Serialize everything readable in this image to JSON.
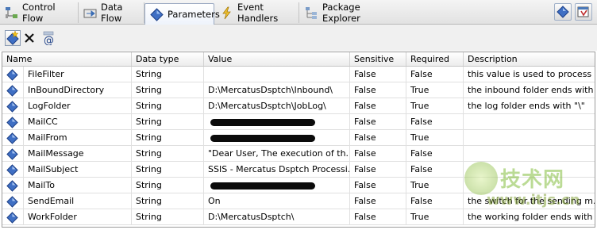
{
  "tabs": [
    {
      "label": "Control Flow",
      "icon": "control-flow-icon"
    },
    {
      "label": "Data Flow",
      "icon": "data-flow-icon"
    },
    {
      "label": "Parameters",
      "icon": "parameters-icon",
      "active": true
    },
    {
      "label": "Event Handlers",
      "icon": "event-handlers-icon"
    },
    {
      "label": "Package Explorer",
      "icon": "package-explorer-icon"
    }
  ],
  "toolbar": {
    "items": [
      "add-parameter-icon",
      "delete-parameter-icon",
      "add-to-configurations-icon"
    ]
  },
  "grid": {
    "columns": [
      "Name",
      "Data type",
      "Value",
      "Sensitive",
      "Required",
      "Description"
    ],
    "rows": [
      {
        "name": "FileFilter",
        "type": "String",
        "value": "",
        "redacted": false,
        "sensitive": "False",
        "required": "False",
        "description": "this value is used to process ..."
      },
      {
        "name": "InBoundDirectory",
        "type": "String",
        "value": "D:\\MercatusDsptch\\Inbound\\",
        "redacted": false,
        "sensitive": "False",
        "required": "True",
        "description": "the inbound folder ends with \"\\\""
      },
      {
        "name": "LogFolder",
        "type": "String",
        "value": "D:\\MercatusDsptch\\JobLog\\",
        "redacted": false,
        "sensitive": "False",
        "required": "True",
        "description": "the log folder ends with \"\\\""
      },
      {
        "name": "MailCC",
        "type": "String",
        "value": "",
        "redacted": true,
        "sensitive": "False",
        "required": "False",
        "description": ""
      },
      {
        "name": "MailFrom",
        "type": "String",
        "value": "",
        "redacted": true,
        "sensitive": "False",
        "required": "True",
        "description": ""
      },
      {
        "name": "MailMessage",
        "type": "String",
        "value": "\"Dear User, The execution of th...",
        "redacted": false,
        "sensitive": "False",
        "required": "False",
        "description": ""
      },
      {
        "name": "MailSubject",
        "type": "String",
        "value": "SSIS - Mercatus Dsptch Processi...",
        "redacted": false,
        "sensitive": "False",
        "required": "False",
        "description": ""
      },
      {
        "name": "MailTo",
        "type": "String",
        "value": "",
        "redacted": true,
        "sensitive": "False",
        "required": "True",
        "description": ""
      },
      {
        "name": "SendEmail",
        "type": "String",
        "value": "On",
        "redacted": false,
        "sensitive": "False",
        "required": "False",
        "description": "the switch for the sending m..."
      },
      {
        "name": "WorkFolder",
        "type": "String",
        "value": "D:\\MercatusDsptch\\",
        "redacted": false,
        "sensitive": "False",
        "required": "True",
        "description": "the working folder ends with \"\\\""
      }
    ]
  },
  "watermark": {
    "line1": "技术网",
    "line2": "www.itjs.cn"
  },
  "colors": {
    "param_icon": "#3f6fc4",
    "tab_border": "#9aa9c2",
    "redaction": "#0b0b0b"
  }
}
